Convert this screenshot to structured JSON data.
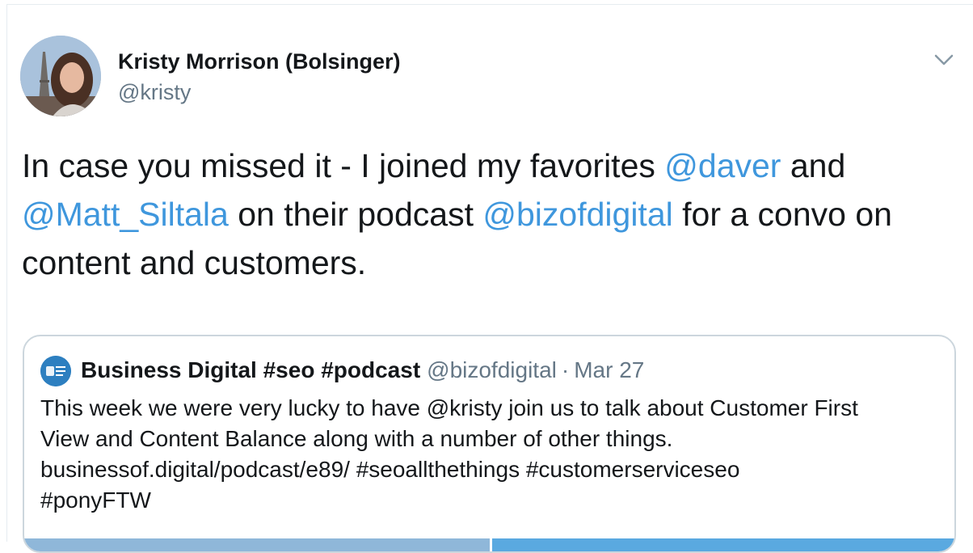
{
  "author": {
    "name": "Kristy Morrison (Bolsinger)",
    "handle": "@kristy"
  },
  "tweet": {
    "seg1": "In case you missed it - I joined my favorites ",
    "mention1": "@daver",
    "seg2": " and ",
    "mention2": "@Matt_Siltala",
    "seg3": " on their podcast ",
    "mention3": "@bizofdigital",
    "seg4": " for a convo on content and customers."
  },
  "quoted": {
    "name": "Business Digital #seo #podcast",
    "handle": "@bizofdigital",
    "separator": "·",
    "date": "Mar 27",
    "line1": "This week we were very lucky to have @kristy join us to talk about Customer First",
    "line2": "View and Content Balance along with a number of other things.",
    "line3": "businessof.digital/podcast/e89/ #seoallthethings #customerserviceseo",
    "line4": "#ponyFTW"
  },
  "colors": {
    "link": "#3f97dd",
    "secondary_text": "#657786",
    "border": "#ccd6dd"
  },
  "icons": {
    "menu": "chevron-down-icon"
  }
}
